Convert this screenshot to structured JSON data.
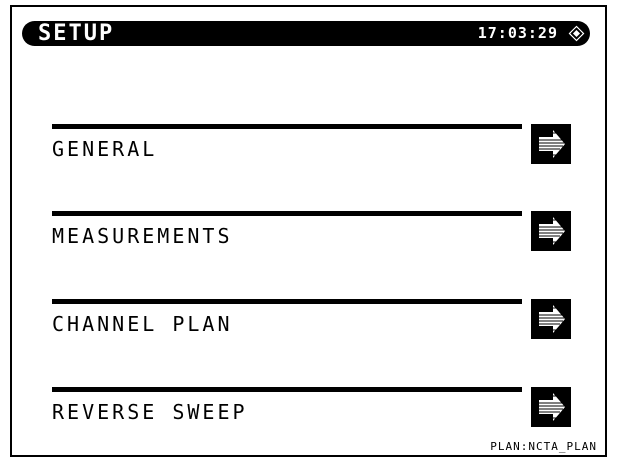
{
  "header": {
    "title": "SETUP",
    "clock": "17:03:29"
  },
  "menu": [
    {
      "label": "GENERAL"
    },
    {
      "label": "MEASUREMENTS"
    },
    {
      "label": "CHANNEL PLAN"
    },
    {
      "label": "REVERSE SWEEP"
    }
  ],
  "footer": {
    "plan": "PLAN:NCTA_PLAN"
  },
  "icons": {
    "status": "diamond-status-icon",
    "menu_arrow": "right-arrow-icon"
  },
  "colors": {
    "foreground": "#000000",
    "background": "#ffffff"
  }
}
